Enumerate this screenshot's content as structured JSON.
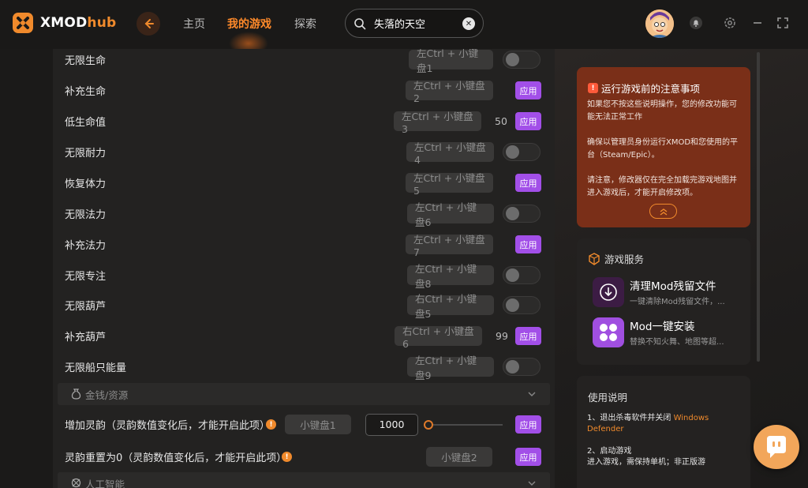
{
  "header": {
    "logo_text": "XMOD",
    "logo_text_accent": "hub",
    "nav": [
      {
        "label": "主页",
        "active": false
      },
      {
        "label": "我的游戏",
        "active": true
      },
      {
        "label": "探索",
        "active": false
      }
    ],
    "search_value": "失落的天空"
  },
  "cheats": [
    {
      "label": "无限生命",
      "hotkey": "左Ctrl + 小键盘1",
      "control": "toggle"
    },
    {
      "label": "补充生命",
      "hotkey": "左Ctrl + 小键盘2",
      "control": "apply"
    },
    {
      "label": "低生命值",
      "hotkey": "左Ctrl + 小键盘3",
      "value": "50",
      "control": "apply"
    },
    {
      "label": "无限耐力",
      "hotkey": "左Ctrl + 小键盘4",
      "control": "toggle"
    },
    {
      "label": "恢复体力",
      "hotkey": "左Ctrl + 小键盘5",
      "control": "apply"
    },
    {
      "label": "无限法力",
      "hotkey": "左Ctrl + 小键盘6",
      "control": "toggle"
    },
    {
      "label": "补充法力",
      "hotkey": "左Ctrl + 小键盘7",
      "control": "apply"
    },
    {
      "label": "无限专注",
      "hotkey": "左Ctrl + 小键盘8",
      "control": "toggle"
    },
    {
      "label": "无限葫芦",
      "hotkey": "右Ctrl + 小键盘5",
      "control": "toggle"
    },
    {
      "label": "补充葫芦",
      "hotkey": "右Ctrl + 小键盘6",
      "value": "99",
      "control": "apply"
    },
    {
      "label": "无限船只能量",
      "hotkey": "左Ctrl + 小键盘9",
      "control": "toggle"
    }
  ],
  "apply_label": "应用",
  "section_money": "金钱/资源",
  "section_ai": "人工智能",
  "money_rows": [
    {
      "label": "增加灵韵（灵韵数值变化后，才能开启此项）",
      "hotkey": "小键盘1",
      "input_value": "1000"
    },
    {
      "label": "灵韵重置为0（灵韵数值变化后，才能开启此项）",
      "hotkey": "小键盘2"
    }
  ],
  "notice": {
    "title": "运行游戏前的注意事项",
    "paragraphs": [
      "如果您不按这些说明操作，您的修改功能可能无法正常工作",
      "确保以管理员身份运行XMOD和您使用的平台（Steam/Epic）。",
      "请注意，修改器仅在完全加载完游戏地图并进入游戏后，才能开启修改项。"
    ]
  },
  "services": {
    "title": "游戏服务",
    "items": [
      {
        "name": "清理Mod残留文件",
        "desc": "一键清除Mod残留文件，..."
      },
      {
        "name": "Mod一键安装",
        "desc": "替换不知火舞、地图等超..."
      }
    ]
  },
  "usage": {
    "title": "使用说明",
    "step1_prefix": "1、退出杀毒软件并关闭",
    "step1_highlight": "Windows Defender",
    "step2_title": "2、启动游戏",
    "step2_body": "进入游戏，需保持单机；非正版游"
  },
  "colors": {
    "accent": "#f08a2c",
    "apply": "#a24fe8",
    "notice_bg": "#7a2f18"
  }
}
